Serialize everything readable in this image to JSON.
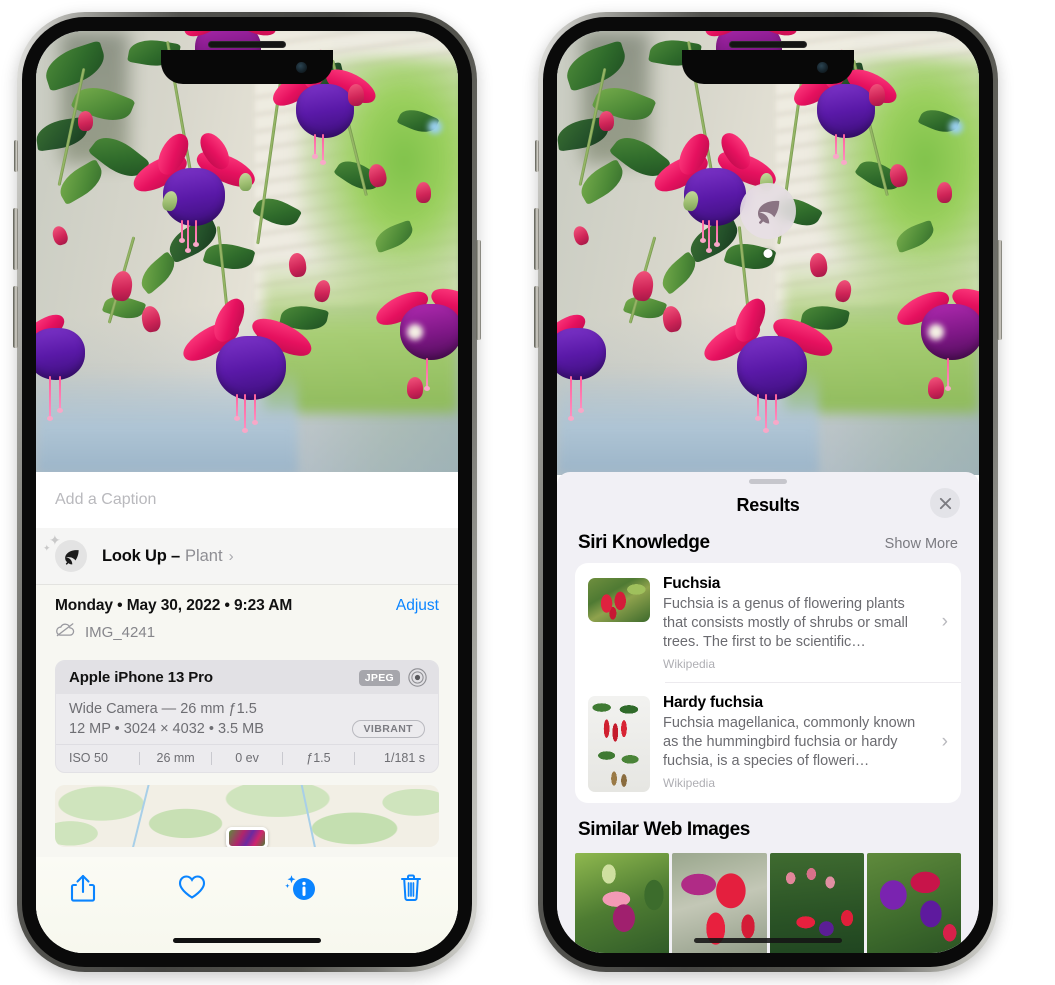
{
  "app": {
    "name": "Photos",
    "platform": "iOS"
  },
  "left_phone": {
    "caption": {
      "placeholder": "Add a Caption",
      "value": ""
    },
    "look_up": {
      "label": "Look Up –",
      "subject": "Plant",
      "icon": "leaf-icon",
      "chevron": "›"
    },
    "metadata": {
      "date": "Monday • May 30, 2022 • 9:23 AM",
      "adjust_label": "Adjust",
      "filename": "IMG_4241",
      "cloud_icon": "cloud-slash-icon"
    },
    "exif": {
      "device": "Apple iPhone 13 Pro",
      "format_badge": "JPEG",
      "raw_icon": "aperture-ring-icon",
      "lens": "Wide Camera — 26 mm ƒ1.5",
      "specs": "12 MP • 3024 × 4032 • 3.5 MB",
      "style_badge": "VIBRANT",
      "shot": [
        {
          "label": "ISO 50"
        },
        {
          "label": "26 mm"
        },
        {
          "label": "0 ev"
        },
        {
          "label": "ƒ1.5"
        },
        {
          "label": "1/181 s"
        }
      ]
    },
    "map": {
      "type": "terrain-map-thumbnail",
      "pin": "photo-pin"
    },
    "toolbar": [
      {
        "name": "share-button",
        "icon": "share-icon"
      },
      {
        "name": "favorite-button",
        "icon": "heart-icon"
      },
      {
        "name": "info-button",
        "icon": "info-sparkle-icon"
      },
      {
        "name": "delete-button",
        "icon": "trash-icon"
      }
    ],
    "accent_color": "#0a84ff"
  },
  "right_phone": {
    "visual_lookup_badge": {
      "icon": "leaf-icon"
    },
    "sheet": {
      "title": "Results",
      "close_icon": "close-icon",
      "sections": [
        {
          "title": "Siri Knowledge",
          "action": "Show More",
          "items": [
            {
              "title": "Fuchsia",
              "description": "Fuchsia is a genus of flowering plants that consists mostly of shrubs or small trees. The first to be scientific…",
              "source": "Wikipedia",
              "chevron": "›"
            },
            {
              "title": "Hardy fuchsia",
              "description": "Fuchsia magellanica, commonly known as the hummingbird fuchsia or hardy fuchsia, is a species of floweri…",
              "source": "Wikipedia",
              "chevron": "›"
            }
          ]
        },
        {
          "title": "Similar Web Images",
          "images": [
            {
              "alt": "pink-white-fuchsia-on-green-leaves"
            },
            {
              "alt": "red-fuchsia-closeup"
            },
            {
              "alt": "fuchsia-bush-with-buds"
            },
            {
              "alt": "purple-and-red-fuchsia-blooms"
            }
          ]
        }
      ]
    }
  }
}
